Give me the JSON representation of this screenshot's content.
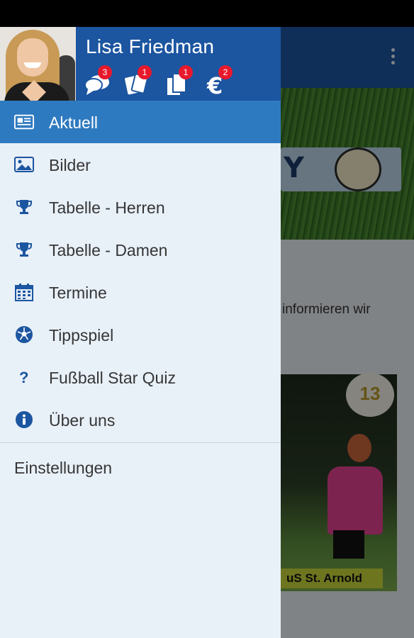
{
  "user": {
    "name": "Lisa Friedman"
  },
  "header_icons": [
    {
      "icon": "messages-icon",
      "badge": "3"
    },
    {
      "icon": "tickets-icon",
      "badge": "1"
    },
    {
      "icon": "documents-icon",
      "badge": "1"
    },
    {
      "icon": "euro-icon",
      "badge": "2"
    }
  ],
  "menu": {
    "items": [
      {
        "label": "Aktuell",
        "icon": "news-icon",
        "active": true
      },
      {
        "label": "Bilder",
        "icon": "image-icon"
      },
      {
        "label": "Tabelle - Herren",
        "icon": "trophy-icon"
      },
      {
        "label": "Tabelle - Damen",
        "icon": "trophy-icon"
      },
      {
        "label": "Termine",
        "icon": "calendar-icon"
      },
      {
        "label": "Tippspiel",
        "icon": "soccer-ball-icon"
      },
      {
        "label": "Fußball Star Quiz",
        "icon": "question-icon"
      },
      {
        "label": "Über uns",
        "icon": "info-icon"
      }
    ],
    "settings_label": "Einstellungen"
  },
  "background": {
    "text_line1": "informieren wir",
    "photo_label": "uS St. Arnold",
    "badge_number": "13"
  },
  "colors": {
    "primary": "#1c55a0",
    "active_item": "#2e7ac0",
    "drawer_bg": "#e8f0f8",
    "icon_blue": "#1c55a0",
    "badge_red": "#e8192c"
  }
}
